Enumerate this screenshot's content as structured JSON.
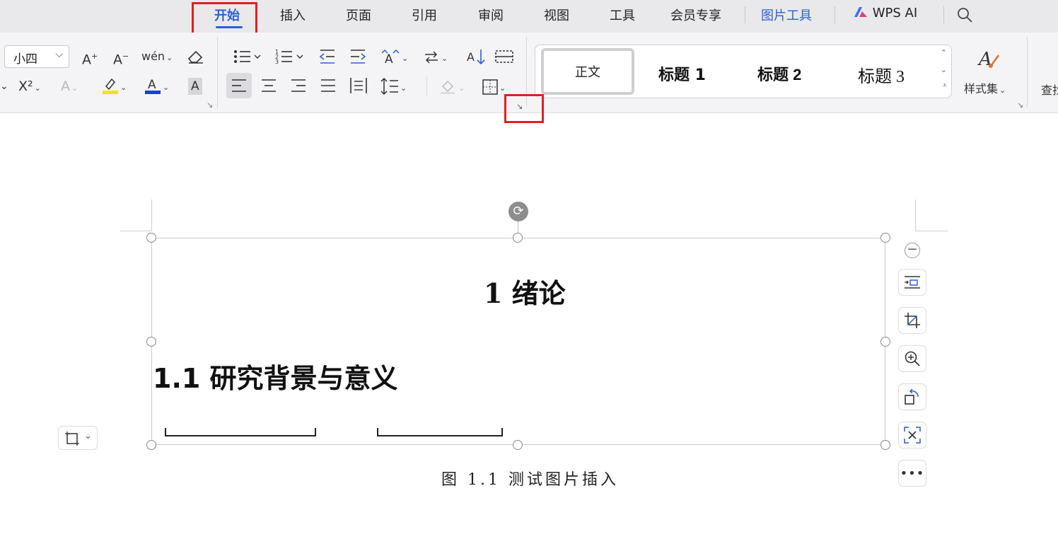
{
  "tabs": [
    {
      "label": "开始",
      "active": true
    },
    {
      "label": "插入"
    },
    {
      "label": "页面"
    },
    {
      "label": "引用"
    },
    {
      "label": "审阅"
    },
    {
      "label": "视图"
    },
    {
      "label": "工具"
    },
    {
      "label": "会员专享"
    },
    {
      "label": "图片工具",
      "highlight": true
    },
    {
      "label": "WPS AI"
    }
  ],
  "icons": {
    "search": "search-icon",
    "wps_ai_logo": "wps-ai-logo-icon"
  },
  "ribbon": {
    "font_size": "小四",
    "increase_font": "A⁺",
    "decrease_font": "A⁻",
    "phonetic": "wén",
    "superscript": "X²",
    "styles": {
      "normal": "正文",
      "heading1": "标题 1",
      "heading2": "标题 2",
      "heading3": "标题 3"
    },
    "style_set_label": "样式集",
    "find_label": "查找"
  },
  "document": {
    "heading1": "1   绪论",
    "heading2": "1.1  研究背景与意义",
    "caption": "图 1.1 测试图片插入"
  },
  "colors": {
    "accent": "#2b5fd9",
    "highlight_box": "#e02020",
    "highlight_yellow": "#f5e600",
    "font_color_blue": "#1a3fd9"
  }
}
